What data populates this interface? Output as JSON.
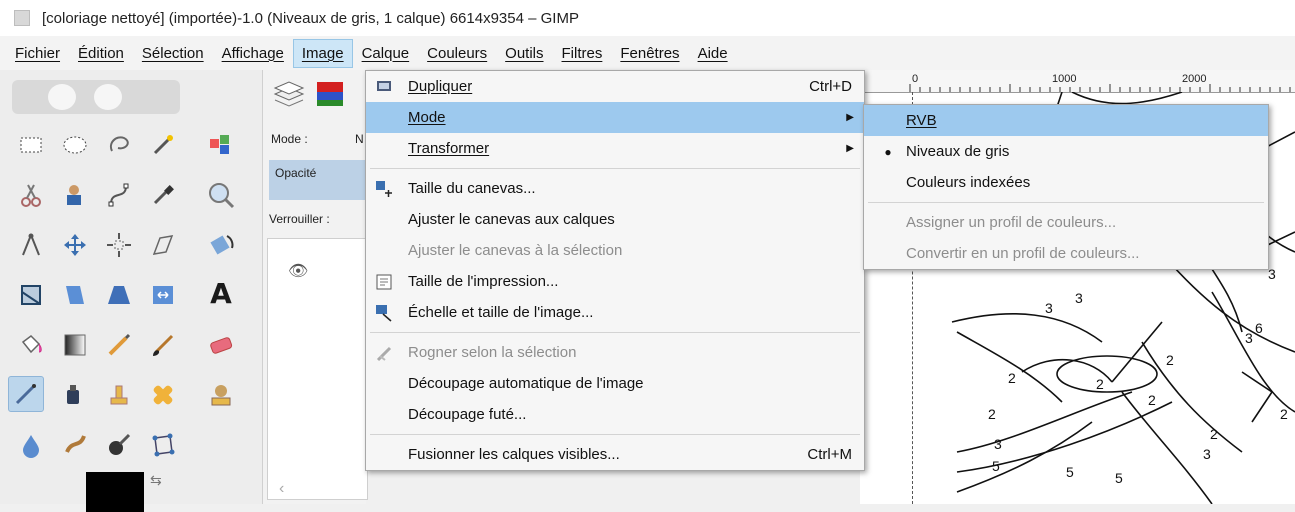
{
  "window": {
    "title": "[coloriage nettoyé] (importée)-1.0 (Niveaux de gris, 1 calque) 6614x9354 – GIMP"
  },
  "menubar": {
    "items": [
      "Fichier",
      "Édition",
      "Sélection",
      "Affichage",
      "Image",
      "Calque",
      "Couleurs",
      "Outils",
      "Filtres",
      "Fenêtres",
      "Aide"
    ],
    "active": "Image"
  },
  "dock": {
    "mode_label": "Mode :",
    "mode_value_partial": "N",
    "opacity_label": "Opacité",
    "lock_label": "Verrouiller :"
  },
  "image_menu": {
    "items": [
      {
        "label": "Dupliquer",
        "shortcut": "Ctrl+D",
        "icon": "duplicate-icon",
        "state": "normal"
      },
      {
        "label": "Mode",
        "submenu": true,
        "state": "highlighted"
      },
      {
        "label": "Transformer",
        "submenu": true,
        "state": "normal"
      },
      {
        "label": "Taille du canevas...",
        "icon": "canvas-size-icon",
        "state": "normal"
      },
      {
        "label": "Ajuster le canevas aux calques",
        "state": "normal"
      },
      {
        "label": "Ajuster le canevas à la sélection",
        "state": "disabled"
      },
      {
        "label": "Taille de l'impression...",
        "icon": "print-size-icon",
        "state": "normal"
      },
      {
        "label": "Échelle et taille de l'image...",
        "icon": "scale-image-icon",
        "state": "normal"
      },
      {
        "label": "Rogner selon la sélection",
        "icon": "crop-icon",
        "state": "disabled"
      },
      {
        "label": "Découpage automatique de l'image",
        "state": "normal"
      },
      {
        "label": "Découpage futé...",
        "state": "normal"
      },
      {
        "label": "Fusionner les calques visibles...",
        "shortcut": "Ctrl+M",
        "state": "normal"
      }
    ]
  },
  "mode_submenu": {
    "items": [
      {
        "label": "RVB",
        "state": "highlighted"
      },
      {
        "label": "Niveaux de gris",
        "checked": true,
        "state": "normal"
      },
      {
        "label": "Couleurs indexées",
        "state": "normal"
      },
      {
        "label": "Assigner un profil de couleurs...",
        "state": "disabled"
      },
      {
        "label": "Convertir en un profil de couleurs...",
        "state": "disabled"
      }
    ]
  },
  "ruler": {
    "ticks": [
      "0",
      "1000",
      "2000"
    ]
  },
  "canvas_numbers": [
    "3",
    "3",
    "6",
    "3",
    "2",
    "2",
    "2",
    "2",
    "2",
    "2",
    "2",
    "3",
    "5",
    "5",
    "5",
    "3",
    "3"
  ]
}
